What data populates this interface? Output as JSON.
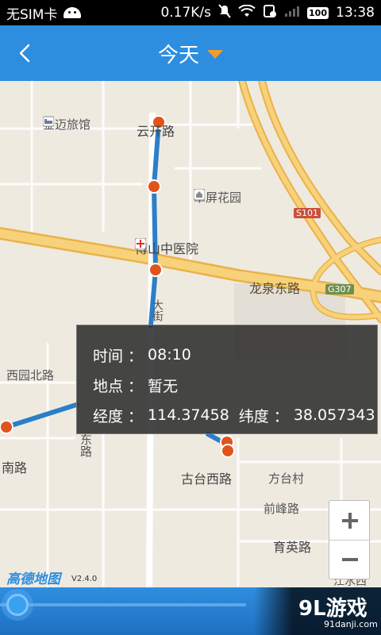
{
  "status_bar": {
    "carrier": "无SIM卡",
    "speed": "0.17K/s",
    "battery": "100",
    "time": "13:38"
  },
  "header": {
    "title": "今天",
    "back_icon": "chevron-left-icon",
    "dropdown_icon": "triangle-down-icon"
  },
  "map": {
    "labels": {
      "hotel": "金迈旅馆",
      "yunfang_road": "云开路",
      "garden": "翠屏花园",
      "s101": "S101",
      "hospital": "傅山中医院",
      "longquan_east_road": "龙泉东路",
      "g307": "G307",
      "xiyuan_north_road": "西园北路",
      "south_road": "南路",
      "east_road_vertical": "东路",
      "street_vertical": "大街",
      "gutai_west_road": "古台西路",
      "fangtai_village": "方台村",
      "qianfeng_road": "前峰路",
      "yuying_road": "育英路",
      "jiangshui": "江水西"
    },
    "logo": "高德地图",
    "version": "V2.4.0"
  },
  "popup": {
    "time_label": "时间",
    "time_value": "08:10",
    "place_label": "地点",
    "place_value": "暂无",
    "longitude_label": "经度",
    "longitude_value": "114.37458",
    "latitude_label": "纬度",
    "latitude_value": "38.057343",
    "colon": "："
  },
  "zoom": {
    "in_icon": "plus-icon",
    "out_icon": "minus-icon"
  },
  "watermark": {
    "title": "9L游戏",
    "site": "91danji.com"
  },
  "colors": {
    "header_blue": "#2d8ee0",
    "route_blue": "#2b7fc8",
    "marker_orange": "#e0541c",
    "road_yellow": "#f6c45a",
    "dropdown_orange": "#f39c2b"
  }
}
